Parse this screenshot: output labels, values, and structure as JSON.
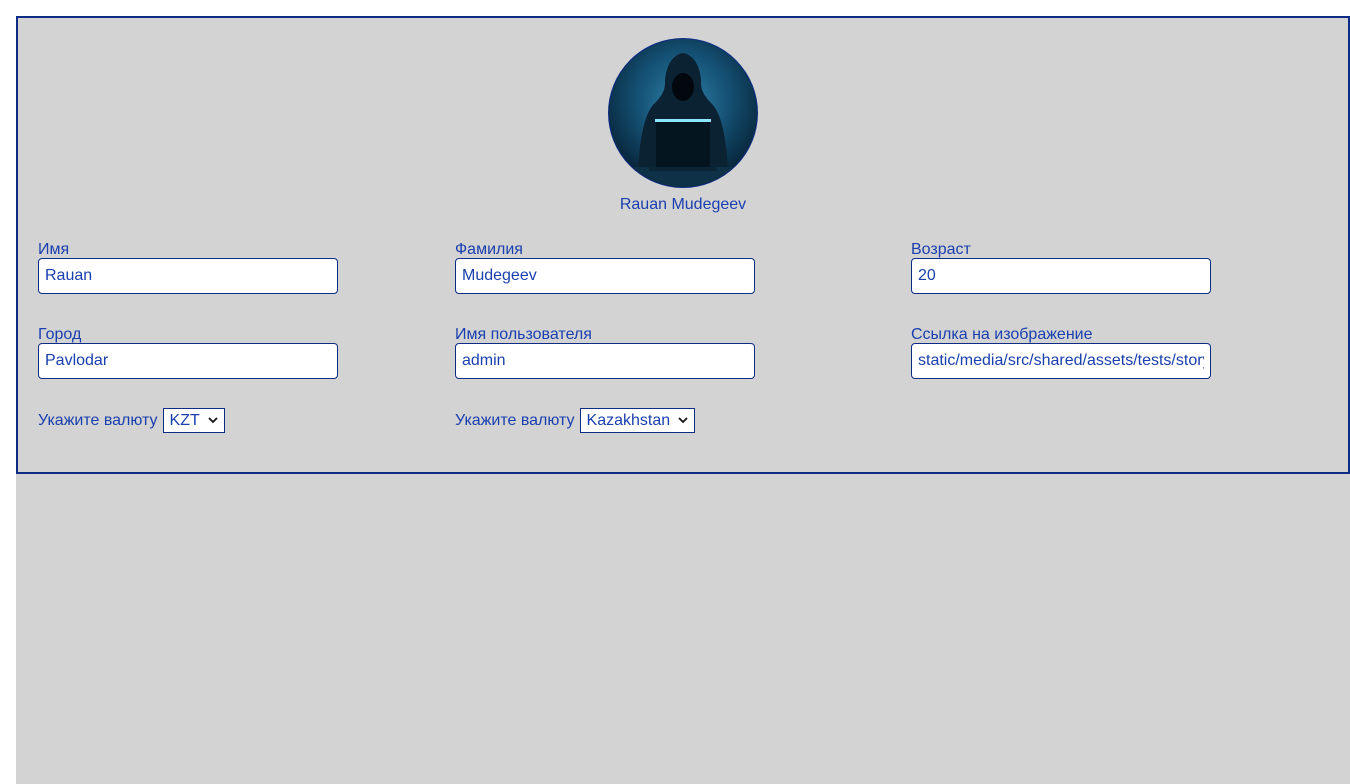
{
  "profile": {
    "full_name": "Rauan Mudegeev",
    "avatar_icon": "hooded-hacker-avatar"
  },
  "fields": {
    "first_name": {
      "label": "Имя",
      "value": "Rauan"
    },
    "last_name": {
      "label": "Фамилия",
      "value": "Mudegeev"
    },
    "age": {
      "label": "Возраст",
      "value": "20"
    },
    "city": {
      "label": "Город",
      "value": "Pavlodar"
    },
    "username": {
      "label": "Имя пользователя",
      "value": "admin"
    },
    "avatar_link": {
      "label": "Ссылка на изображение",
      "value": "static/media/src/shared/assets/tests/storybook.jpg"
    }
  },
  "currency": {
    "label": "Укажите валюту",
    "selected": "KZT"
  },
  "country": {
    "label": "Укажите валюту",
    "selected": "Kazakhstan"
  },
  "colors": {
    "accent": "#1a3fae",
    "border": "#0c2c86",
    "background": "#d3d3d3"
  }
}
